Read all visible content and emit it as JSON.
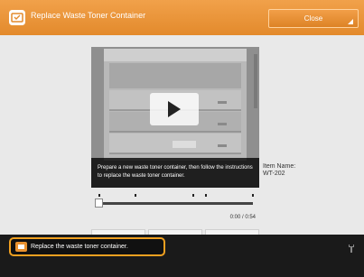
{
  "header": {
    "title": "Replace Waste Toner Container",
    "close_label": "Close"
  },
  "video": {
    "caption": "Prepare a new waste toner container, then follow the instructions to replace the waste toner container.",
    "time": "0:00 / 0:54",
    "progress": 0.0
  },
  "item": {
    "name_label": "Item Name:",
    "name_value": "WT-202"
  },
  "status": {
    "message": "Replace the waste toner container."
  },
  "colors": {
    "header_orange": "#e8912f",
    "status_border": "#f0a020"
  }
}
